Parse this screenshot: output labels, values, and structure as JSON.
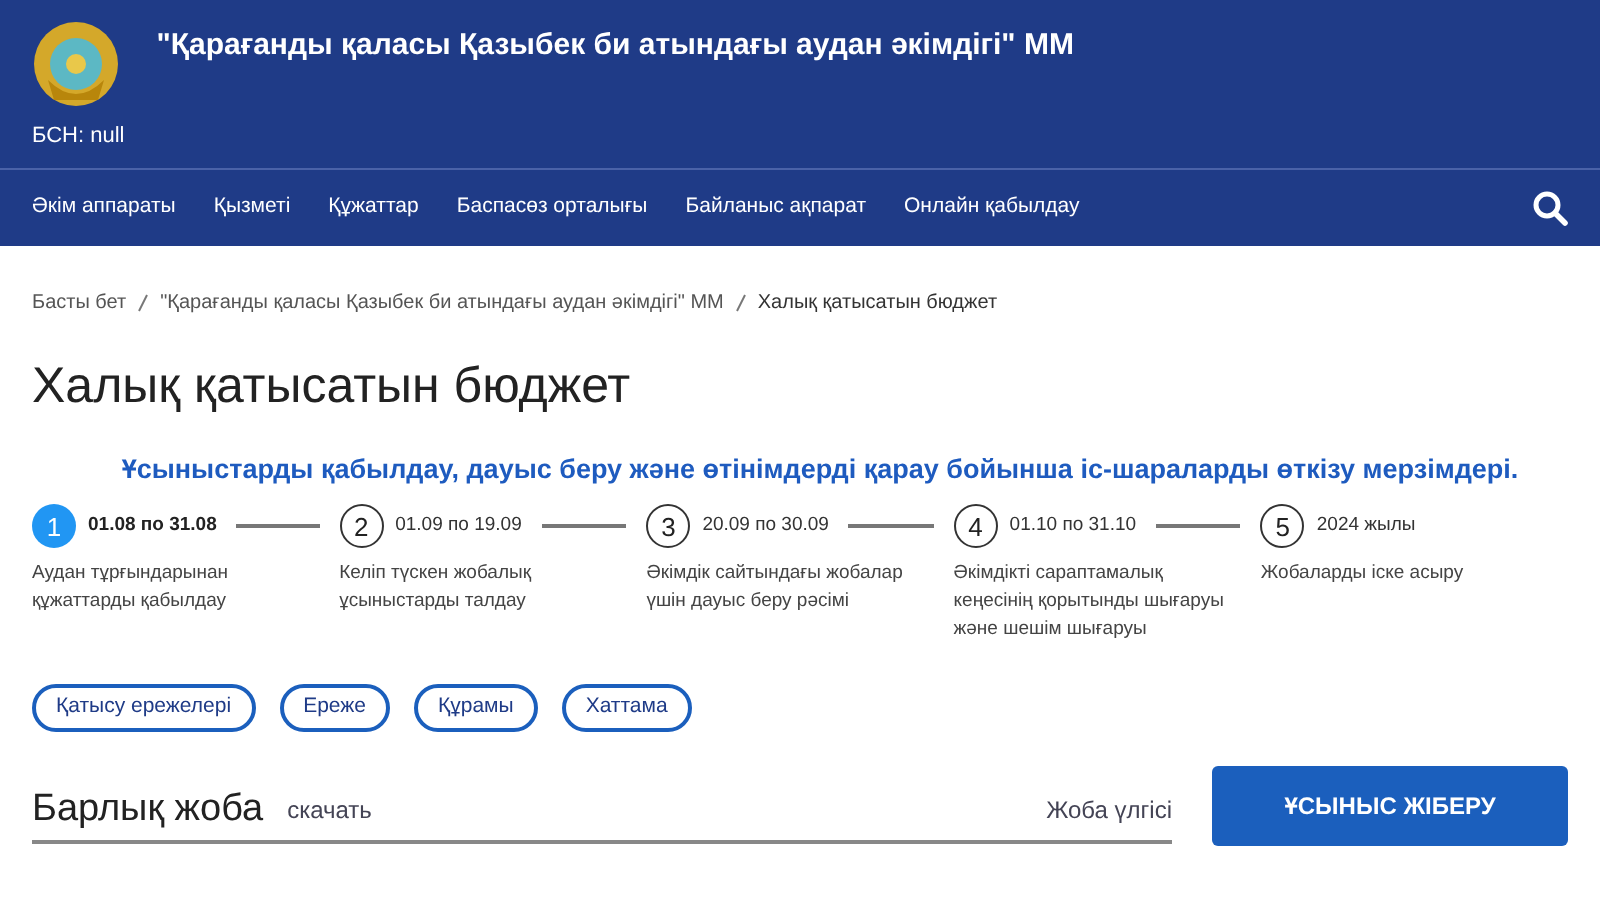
{
  "header": {
    "org_name": "\"Қарағанды қаласы Қазыбек би атындағы аудан әкімдігі\" ММ",
    "bin": "БСН: null"
  },
  "nav": {
    "items": [
      {
        "label": "Әкім аппараты"
      },
      {
        "label": "Қызметі"
      },
      {
        "label": "Құжаттар"
      },
      {
        "label": "Баспасөз орталығы"
      },
      {
        "label": "Байланыс ақпарат"
      },
      {
        "label": "Онлайн қабылдау"
      }
    ]
  },
  "breadcrumb": [
    "Басты бет",
    "\"Қарағанды қаласы Қазыбек би атындағы аудан әкімдігі\" ММ",
    "Халық қатысатын бюджет"
  ],
  "page_title": "Халық қатысатын бюджет",
  "timeline": {
    "heading": "Ұсыныстарды қабылдау, дауыс беру және өтінімдерді қарау бойынша іс-шараларды өткізу мерзімдері.",
    "steps": [
      {
        "number": "1",
        "date": "01.08 по 31.08",
        "description": "Аудан тұрғындарынан құжаттарды қабылдау",
        "selected": true
      },
      {
        "number": "2",
        "date": "01.09 по 19.09",
        "description": "Келіп түскен жобалық ұсыныстарды талдау",
        "selected": false
      },
      {
        "number": "3",
        "date": "20.09 по 30.09",
        "description": "Әкімдік сайтындағы жобалар үшін дауыс беру рәсімі",
        "selected": false
      },
      {
        "number": "4",
        "date": "01.10 по 31.10",
        "description": "Әкімдікті сараптамалық кеңесінің қорытынды шығаруы және шешім шығаруы",
        "selected": false
      },
      {
        "number": "5",
        "date": "2024 жылы",
        "description": "Жобаларды іске асыру",
        "selected": false
      }
    ]
  },
  "documents": [
    "Қатысу ережелері",
    "Ереже",
    "Құрамы",
    "Хаттама"
  ],
  "projects": {
    "title": "Барлық жоба",
    "download": "скачать",
    "template": "Жоба үлгісі",
    "submit": "ҰСЫНЫС ЖІБЕРУ"
  }
}
